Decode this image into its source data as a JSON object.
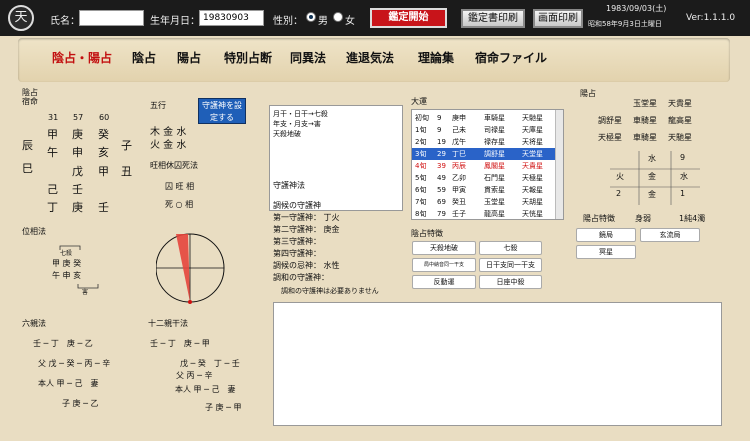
{
  "header": {
    "logo_char": "天",
    "name_label": "氏名：",
    "name_value": "",
    "birth_label": "生年月日：",
    "birth_value": "19830903",
    "sex_label": "性別：",
    "sex_male": "男",
    "sex_female": "女",
    "start_button": "鑑定開始",
    "print_report_button": "鑑定書印刷",
    "print_screen_button": "画面印刷",
    "date": "1983/09/03(土)",
    "date_jp": "昭和58年9月3日土曜日",
    "version": "Ver:1.1.1.0"
  },
  "nav": [
    "陰占・陽占",
    "陰占",
    "陽占",
    "特別占断",
    "同異法",
    "進退気法",
    "理論集",
    "宿命ファイル"
  ],
  "inzen": {
    "title": "陰占",
    "subtitle": "宿命",
    "numbers": [
      "31",
      "57",
      "60"
    ],
    "row1": [
      "甲",
      "庚",
      "癸"
    ],
    "row1_right": "子",
    "row2_left": "辰",
    "row2": [
      "午",
      "申",
      "亥"
    ],
    "row3_left": "巳",
    "row3": [
      "戊",
      "甲",
      "丑"
    ],
    "row4": [
      "己",
      "壬"
    ],
    "row5": [
      "丁",
      "庚",
      "壬"
    ]
  },
  "gogyo": {
    "title": "五行",
    "line1": "木 金 水",
    "line2": "火 金 水",
    "button": "守護神を設定する",
    "okyu_title": "旺相休囚死法",
    "okyu1": "囚 旺 相",
    "okyu2": "死 ○ 相"
  },
  "notes": [
    "月干・日干→七殺",
    "年支・月支→害",
    "天殺地破"
  ],
  "shugo": {
    "title": "守護神法",
    "lines": [
      "調候の守護神",
      "第一守護神： 丁火",
      "第二守護神： 庚金",
      "第三守護神：",
      "第四守護神：",
      "調候の忌神： 水性",
      "調和の守護神："
    ],
    "note": "調和の守護神は必要ありません"
  },
  "daiun": {
    "title": "大運",
    "rows": [
      [
        "初旬",
        "9",
        "庚申",
        "車騎星",
        "天馳星"
      ],
      [
        "1旬",
        "9",
        "己未",
        "司禄星",
        "天庫星"
      ],
      [
        "2旬",
        "19",
        "戊午",
        "禄存星",
        "天将星"
      ],
      [
        "3旬",
        "29",
        "丁巳",
        "調舒星",
        "天堂星"
      ],
      [
        "4旬",
        "39",
        "丙辰",
        "鳳閣星",
        "天貴星"
      ],
      [
        "5旬",
        "49",
        "乙卯",
        "石門星",
        "天極星"
      ],
      [
        "6旬",
        "59",
        "甲寅",
        "貫索星",
        "天報星"
      ],
      [
        "7旬",
        "69",
        "癸丑",
        "玉堂星",
        "天胡星"
      ],
      [
        "8旬",
        "79",
        "壬子",
        "龍高星",
        "天恍星"
      ]
    ]
  },
  "inzen_tokucho": {
    "title": "陰占特徴",
    "items": [
      "天殺地破",
      "七殺",
      "局中納音同一干支",
      "日干支同一干支",
      "反動運",
      "日座中殺"
    ]
  },
  "yozen": {
    "title": "陽占",
    "grid": [
      "",
      "玉堂星",
      "天貴星",
      "調舒星",
      "車騎星",
      "龍高星",
      "天極星",
      "車騎星",
      "天馳星"
    ],
    "gogyo_grid": [
      "",
      "水",
      "9",
      "火",
      "金",
      "水",
      "2",
      "金",
      "1"
    ],
    "tokucho_title": "陽占特徴",
    "mi": "身弱",
    "kyoku": "1純4濁",
    "items": [
      "鏡局",
      "玄流局",
      "冥星"
    ]
  },
  "isoho": {
    "title": "位相法",
    "top": "七殺",
    "row1": "甲 庚 癸",
    "row2": "午 申 亥",
    "bottom": "害"
  },
  "rokushin": {
    "title": "六親法",
    "lines": [
      "壬 ─ 丁　庚 ─ 乙",
      "父 戊 ─ 癸 ─ 丙 ─ 辛",
      "本人 甲 ─ 己　妻",
      "子 庚 ─ 乙"
    ]
  },
  "junishin": {
    "title": "十二親干法",
    "lines": [
      "壬 ─ 丁　庚 ─ 甲",
      "戊 ─ 癸　丁 ─ 壬",
      "父 丙 ─ 辛",
      "本人 甲 ─ 己　妻",
      "子 庚 ─ 甲"
    ]
  },
  "colors": {
    "accent_red": "#c8141a",
    "selected": "#2a63c8",
    "parchment": "#e9ddc2"
  }
}
